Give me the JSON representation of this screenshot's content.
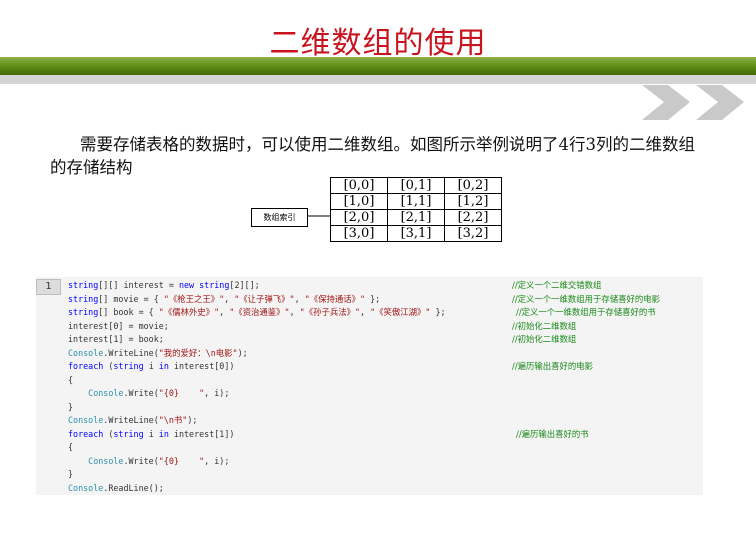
{
  "slide": {
    "title": "二维数组的使用",
    "description": "需要存储表格的数据时，可以使用二维数组。如图所示举例说明了4行3列的二维数组的存储结构",
    "index_label": "数组索引",
    "array_cells": [
      [
        "[0,0]",
        "[0,1]",
        "[0,2]"
      ],
      [
        "[1,0]",
        "[1,1]",
        "[1,2]"
      ],
      [
        "[2,0]",
        "[2,1]",
        "[2,2]"
      ],
      [
        "[3,0]",
        "[3,1]",
        "[3,2]"
      ]
    ]
  },
  "code": {
    "line_number": "1",
    "lines": [
      "string[][] interest = new string[2][];",
      "string[] movie = { \"《枪王之王》\", \"《让子弹飞》\", \"《保持通话》\" };",
      "string[] book = { \"《儒林外史》\", \"《资治通鉴》\", \"《孙子兵法》\", \"《笑傲江湖》\" };",
      "interest[0] = movie;",
      "interest[1] = book;",
      "Console.WriteLine(\"我的爱好：\\n电影\");",
      "foreach (string i in interest[0])",
      "{",
      "    Console.Write(\"{0}    \", i);",
      "}",
      "Console.WriteLine(\"\\n书\");",
      "foreach (string i in interest[1])",
      "{",
      "    Console.Write(\"{0}    \", i);",
      "}",
      "Console.ReadLine();"
    ],
    "comments": [
      "//定义一个二维交错数组",
      "//定义一个一维数组用于存储喜好的电影",
      "//定义一个一维数组用于存储喜好的书",
      "//初始化二维数组",
      "//初始化二维数组",
      "",
      "//遍历输出喜好的电影",
      "",
      "",
      "",
      "",
      "//遍历输出喜好的书",
      "",
      "",
      "",
      ""
    ]
  },
  "colors": {
    "title": "#c8141e",
    "keyword": "#0000ff",
    "type": "#2b91af",
    "string": "#a31515",
    "comment": "#1a8a1a",
    "code_text": "#333333"
  }
}
